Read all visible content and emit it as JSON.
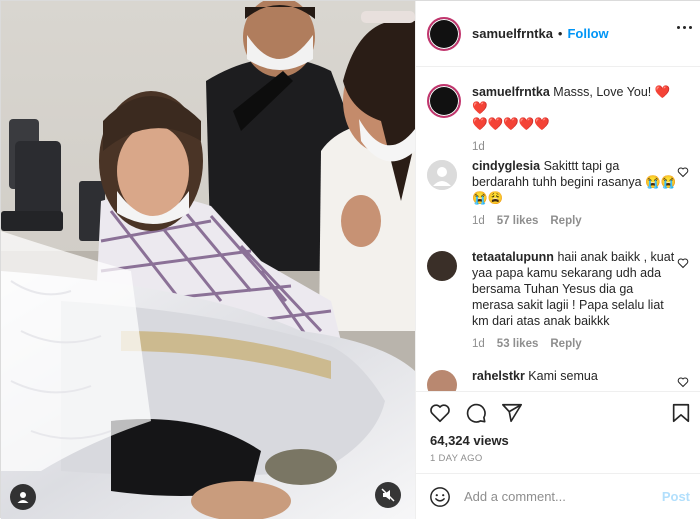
{
  "post": {
    "username": "samuelfrntka",
    "separator": "•",
    "follow_label": "Follow",
    "caption_text": "Masss, Love You! ❤️❤️",
    "caption_hearts": "❤️❤️❤️❤️❤️",
    "caption_age": "1d"
  },
  "comments": [
    {
      "username": "cindyglesia",
      "text": "Sakittt tapi ga berdarahh tuhh begini rasanya 😭😭😭😩",
      "age": "1d",
      "likes": "57 likes",
      "reply": "Reply"
    },
    {
      "username": "tetaatalupunn",
      "text": "haii anak baikk , kuat yaa papa kamu sekarang udh ada bersama Tuhan Yesus dia ga merasa sakit lagii ! Papa selalu liat km dari atas anak baikkk",
      "age": "1d",
      "likes": "53 likes",
      "reply": "Reply"
    },
    {
      "username": "rahelstkr",
      "text": "Kami semua",
      "age": "",
      "likes": "",
      "reply": ""
    }
  ],
  "stats": {
    "views": "64,324 views",
    "date": "1 DAY AGO"
  },
  "composer": {
    "placeholder": "Add a comment...",
    "post_label": "Post"
  },
  "colors": {
    "follow_blue": "#0095f6",
    "heart_red": "#ed4956",
    "story_ring": "#c1356d",
    "muted_text": "#8e8e8e"
  },
  "icons": [
    "user-tag-icon",
    "mute-icon",
    "more-options-icon",
    "heart-icon",
    "comment-icon",
    "share-icon",
    "bookmark-icon",
    "emoji-icon"
  ]
}
